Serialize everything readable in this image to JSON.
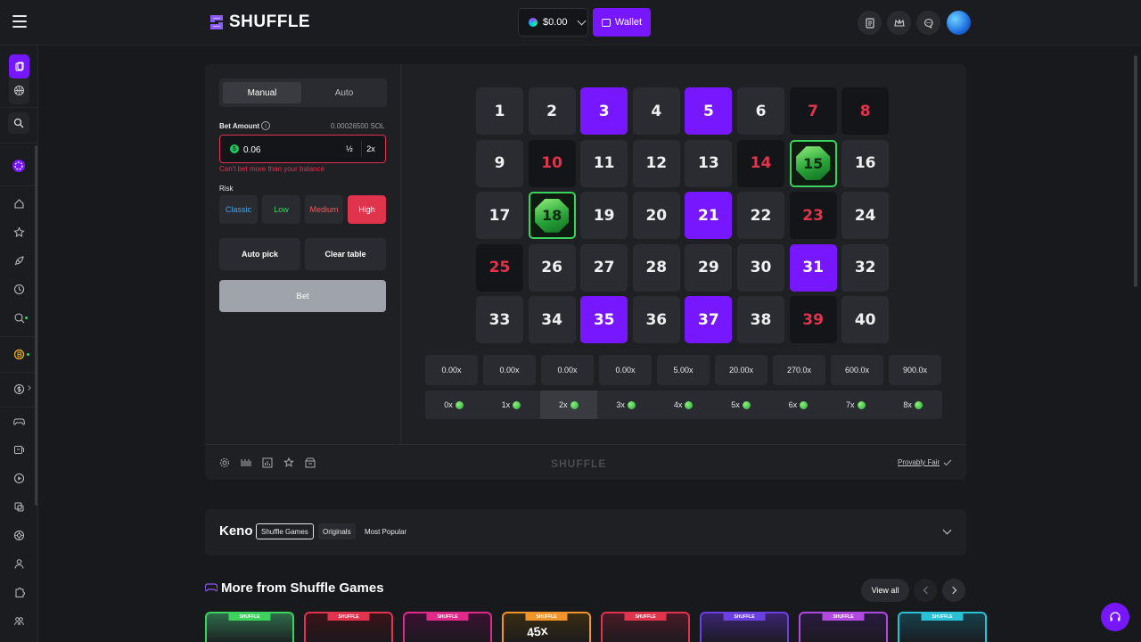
{
  "brand": {
    "name": "SHUFFLE",
    "accent": "#7717ff"
  },
  "header": {
    "balance": "$0.00",
    "wallet_label": "Wallet"
  },
  "controls": {
    "modes": [
      "Manual",
      "Auto"
    ],
    "active_mode": "Manual",
    "bet_amount_label": "Bet Amount",
    "bet_amount_sol": "0.00026500 SOL",
    "bet_value": "0.06",
    "half_label": "½",
    "double_label": "2x",
    "error": "Can't bet more than your balance",
    "risk_label": "Risk",
    "risk_options": [
      "Classic",
      "Low",
      "Medium",
      "High"
    ],
    "active_risk": "High",
    "auto_pick_label": "Auto pick",
    "clear_label": "Clear table",
    "bet_label": "Bet"
  },
  "board": {
    "numbers": [
      1,
      2,
      3,
      4,
      5,
      6,
      7,
      8,
      9,
      10,
      11,
      12,
      13,
      14,
      15,
      16,
      17,
      18,
      19,
      20,
      21,
      22,
      23,
      24,
      25,
      26,
      27,
      28,
      29,
      30,
      31,
      32,
      33,
      34,
      35,
      36,
      37,
      38,
      39,
      40
    ],
    "selected": [
      3,
      5,
      21,
      31,
      35,
      37
    ],
    "drawn_miss": [
      7,
      8,
      10,
      14,
      23,
      25,
      39
    ],
    "hits": [
      15,
      18
    ]
  },
  "multipliers": [
    "0.00x",
    "0.00x",
    "0.00x",
    "0.00x",
    "5.00x",
    "20.00x",
    "270.0x",
    "600.0x",
    "900.0x"
  ],
  "hit_counts": [
    "0x",
    "1x",
    "2x",
    "3x",
    "4x",
    "5x",
    "6x",
    "7x",
    "8x"
  ],
  "active_hit": "2x",
  "footer": {
    "logo": "SHUFFLE",
    "provably_fair": "Provably Fair"
  },
  "info": {
    "title": "Keno",
    "tags": [
      "Shuffle Games",
      "Originals",
      "Most Popular"
    ]
  },
  "more": {
    "title": "More from Shuffle Games",
    "view_all": "View all",
    "cards": [
      {
        "tag": "SHUFFLE",
        "border": "#3bd35c",
        "tagbg": "#3bd35c",
        "bg": "#2e6b4a"
      },
      {
        "tag": "SHUFFLE",
        "border": "#e0344d",
        "tagbg": "#e0344d",
        "bg": "#3a1218"
      },
      {
        "tag": "SHUFFLE",
        "border": "#e02a8a",
        "tagbg": "#e02a8a",
        "bg": "#3a1030"
      },
      {
        "tag": "SHUFFLE",
        "border": "#f0952a",
        "tagbg": "#f0952a",
        "bg": "#3a2c12",
        "text": "45x"
      },
      {
        "tag": "SHUFFLE",
        "border": "#e0344d",
        "tagbg": "#e0344d",
        "bg": "#4a1a26"
      },
      {
        "tag": "SHUFFLE",
        "border": "#6b40e0",
        "tagbg": "#6b40e0",
        "bg": "#3a2470"
      },
      {
        "tag": "SHUFFLE",
        "border": "#b24ae0",
        "tagbg": "#b24ae0",
        "bg": "#2a1a40"
      },
      {
        "tag": "SHUFFLE",
        "border": "#2ac0d6",
        "tagbg": "#2ac0d6",
        "bg": "#16404a"
      }
    ]
  }
}
